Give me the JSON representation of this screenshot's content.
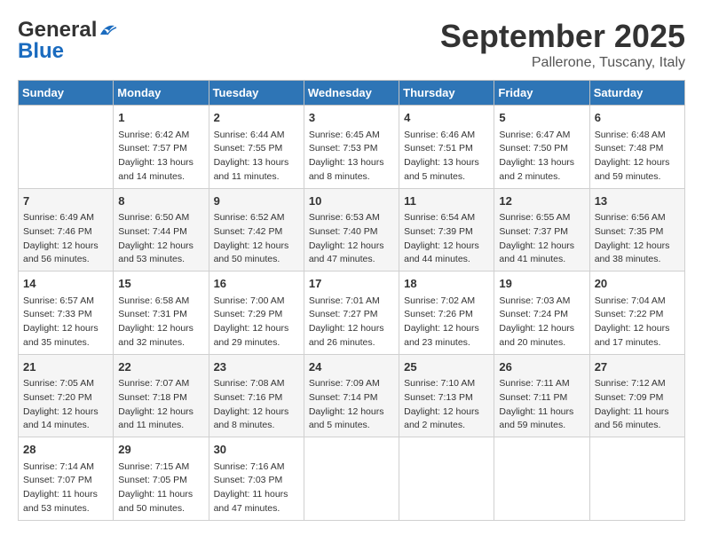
{
  "header": {
    "logo_line1": "General",
    "logo_line2": "Blue",
    "month": "September 2025",
    "location": "Pallerone, Tuscany, Italy"
  },
  "days_of_week": [
    "Sunday",
    "Monday",
    "Tuesday",
    "Wednesday",
    "Thursday",
    "Friday",
    "Saturday"
  ],
  "weeks": [
    [
      {
        "day": "",
        "content": ""
      },
      {
        "day": "1",
        "content": "Sunrise: 6:42 AM\nSunset: 7:57 PM\nDaylight: 13 hours\nand 14 minutes."
      },
      {
        "day": "2",
        "content": "Sunrise: 6:44 AM\nSunset: 7:55 PM\nDaylight: 13 hours\nand 11 minutes."
      },
      {
        "day": "3",
        "content": "Sunrise: 6:45 AM\nSunset: 7:53 PM\nDaylight: 13 hours\nand 8 minutes."
      },
      {
        "day": "4",
        "content": "Sunrise: 6:46 AM\nSunset: 7:51 PM\nDaylight: 13 hours\nand 5 minutes."
      },
      {
        "day": "5",
        "content": "Sunrise: 6:47 AM\nSunset: 7:50 PM\nDaylight: 13 hours\nand 2 minutes."
      },
      {
        "day": "6",
        "content": "Sunrise: 6:48 AM\nSunset: 7:48 PM\nDaylight: 12 hours\nand 59 minutes."
      }
    ],
    [
      {
        "day": "7",
        "content": "Sunrise: 6:49 AM\nSunset: 7:46 PM\nDaylight: 12 hours\nand 56 minutes."
      },
      {
        "day": "8",
        "content": "Sunrise: 6:50 AM\nSunset: 7:44 PM\nDaylight: 12 hours\nand 53 minutes."
      },
      {
        "day": "9",
        "content": "Sunrise: 6:52 AM\nSunset: 7:42 PM\nDaylight: 12 hours\nand 50 minutes."
      },
      {
        "day": "10",
        "content": "Sunrise: 6:53 AM\nSunset: 7:40 PM\nDaylight: 12 hours\nand 47 minutes."
      },
      {
        "day": "11",
        "content": "Sunrise: 6:54 AM\nSunset: 7:39 PM\nDaylight: 12 hours\nand 44 minutes."
      },
      {
        "day": "12",
        "content": "Sunrise: 6:55 AM\nSunset: 7:37 PM\nDaylight: 12 hours\nand 41 minutes."
      },
      {
        "day": "13",
        "content": "Sunrise: 6:56 AM\nSunset: 7:35 PM\nDaylight: 12 hours\nand 38 minutes."
      }
    ],
    [
      {
        "day": "14",
        "content": "Sunrise: 6:57 AM\nSunset: 7:33 PM\nDaylight: 12 hours\nand 35 minutes."
      },
      {
        "day": "15",
        "content": "Sunrise: 6:58 AM\nSunset: 7:31 PM\nDaylight: 12 hours\nand 32 minutes."
      },
      {
        "day": "16",
        "content": "Sunrise: 7:00 AM\nSunset: 7:29 PM\nDaylight: 12 hours\nand 29 minutes."
      },
      {
        "day": "17",
        "content": "Sunrise: 7:01 AM\nSunset: 7:27 PM\nDaylight: 12 hours\nand 26 minutes."
      },
      {
        "day": "18",
        "content": "Sunrise: 7:02 AM\nSunset: 7:26 PM\nDaylight: 12 hours\nand 23 minutes."
      },
      {
        "day": "19",
        "content": "Sunrise: 7:03 AM\nSunset: 7:24 PM\nDaylight: 12 hours\nand 20 minutes."
      },
      {
        "day": "20",
        "content": "Sunrise: 7:04 AM\nSunset: 7:22 PM\nDaylight: 12 hours\nand 17 minutes."
      }
    ],
    [
      {
        "day": "21",
        "content": "Sunrise: 7:05 AM\nSunset: 7:20 PM\nDaylight: 12 hours\nand 14 minutes."
      },
      {
        "day": "22",
        "content": "Sunrise: 7:07 AM\nSunset: 7:18 PM\nDaylight: 12 hours\nand 11 minutes."
      },
      {
        "day": "23",
        "content": "Sunrise: 7:08 AM\nSunset: 7:16 PM\nDaylight: 12 hours\nand 8 minutes."
      },
      {
        "day": "24",
        "content": "Sunrise: 7:09 AM\nSunset: 7:14 PM\nDaylight: 12 hours\nand 5 minutes."
      },
      {
        "day": "25",
        "content": "Sunrise: 7:10 AM\nSunset: 7:13 PM\nDaylight: 12 hours\nand 2 minutes."
      },
      {
        "day": "26",
        "content": "Sunrise: 7:11 AM\nSunset: 7:11 PM\nDaylight: 11 hours\nand 59 minutes."
      },
      {
        "day": "27",
        "content": "Sunrise: 7:12 AM\nSunset: 7:09 PM\nDaylight: 11 hours\nand 56 minutes."
      }
    ],
    [
      {
        "day": "28",
        "content": "Sunrise: 7:14 AM\nSunset: 7:07 PM\nDaylight: 11 hours\nand 53 minutes."
      },
      {
        "day": "29",
        "content": "Sunrise: 7:15 AM\nSunset: 7:05 PM\nDaylight: 11 hours\nand 50 minutes."
      },
      {
        "day": "30",
        "content": "Sunrise: 7:16 AM\nSunset: 7:03 PM\nDaylight: 11 hours\nand 47 minutes."
      },
      {
        "day": "",
        "content": ""
      },
      {
        "day": "",
        "content": ""
      },
      {
        "day": "",
        "content": ""
      },
      {
        "day": "",
        "content": ""
      }
    ]
  ]
}
